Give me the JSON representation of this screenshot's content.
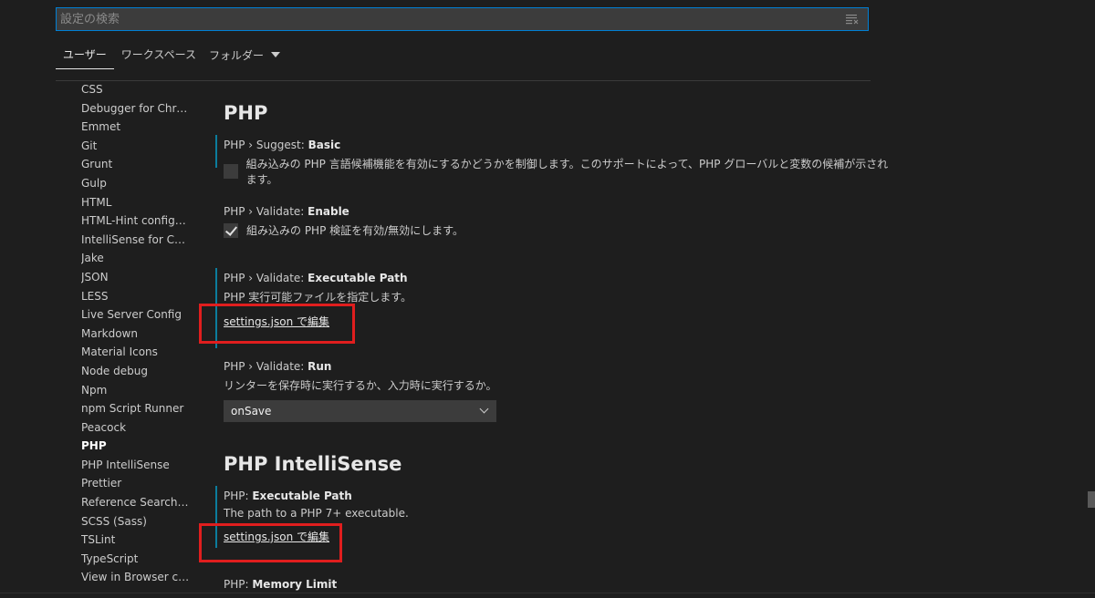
{
  "search": {
    "placeholder": "設定の検索"
  },
  "tabs": {
    "user": "ユーザー",
    "workspace": "ワークスペース",
    "folder": "フォルダー"
  },
  "toc": [
    "CSS",
    "Debugger for Chro...",
    "Emmet",
    "Git",
    "Grunt",
    "Gulp",
    "HTML",
    "HTML-Hint configu...",
    "IntelliSense for CSS...",
    "Jake",
    "JSON",
    "LESS",
    "Live Server Config",
    "Markdown",
    "Material Icons",
    "Node debug",
    "Npm",
    "npm Script Runner",
    "Peacock",
    "PHP",
    "PHP IntelliSense",
    "Prettier",
    "Reference Search V...",
    "SCSS (Sass)",
    "TSLint",
    "TypeScript",
    "View in Browser co..."
  ],
  "toc_active": "PHP",
  "sections": {
    "php": {
      "title": "PHP",
      "suggest": {
        "prefix": "PHP › Suggest: ",
        "name": "Basic",
        "desc": "組み込みの PHP 言語候補機能を有効にするかどうかを制御します。このサポートによって、PHP グローバルと変数の候補が示されます。",
        "checked": false
      },
      "validate_enable": {
        "prefix": "PHP › Validate: ",
        "name": "Enable",
        "desc": "組み込みの PHP 検証を有効/無効にします。",
        "checked": true
      },
      "validate_path": {
        "prefix": "PHP › Validate: ",
        "name": "Executable Path",
        "desc": "PHP 実行可能ファイルを指定します。",
        "link": "settings.json で編集"
      },
      "validate_run": {
        "prefix": "PHP › Validate: ",
        "name": "Run",
        "desc": "リンターを保存時に実行するか、入力時に実行するか。",
        "value": "onSave"
      }
    },
    "intellisense": {
      "title": "PHP IntelliSense",
      "exec_path": {
        "prefix": "PHP: ",
        "name": "Executable Path",
        "desc": "The path to a PHP 7+ executable.",
        "link": "settings.json で編集"
      },
      "memory_limit": {
        "prefix": "PHP: ",
        "name": "Memory Limit"
      }
    }
  },
  "colors": {
    "background": "#1e1e1e",
    "modified_bar": "#0c7d9d",
    "highlight": "#e01e1e"
  }
}
